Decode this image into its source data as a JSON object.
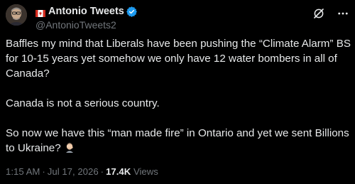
{
  "colors": {
    "background": "#000000",
    "text": "#e7e9ea",
    "muted": "#71767b",
    "verified_blue": "#1d9bf0",
    "flag_red": "#d52b1e"
  },
  "author": {
    "display_name": "Antonio Tweets",
    "handle": "@AntonioTweets2",
    "flag_icon": "canada-flag-icon",
    "verified_icon": "verified-badge-icon",
    "avatar_icon": "avatar"
  },
  "actions": {
    "grok_icon": "grok-icon",
    "more_icon": "more-options-icon"
  },
  "tweet": {
    "paragraph_1": [
      "Baffles my mind that Liberals have been pushing the “Climate Alarm” BS",
      "for 10-15 years yet somehow we only have 12 water bombers in all of",
      "Canada?"
    ],
    "paragraph_2": [
      "Canada is not a serious country."
    ],
    "paragraph_3": [
      "So now we have this “man made fire” in Ontario and yet we sent Billions",
      "to Ukraine?"
    ],
    "emoji_icon": "man-facepalming-emoji"
  },
  "meta": {
    "time": "1:15 AM",
    "separator": "·",
    "date": "Jul 17, 2026",
    "views_count": "17.4K",
    "views_label": "Views"
  }
}
